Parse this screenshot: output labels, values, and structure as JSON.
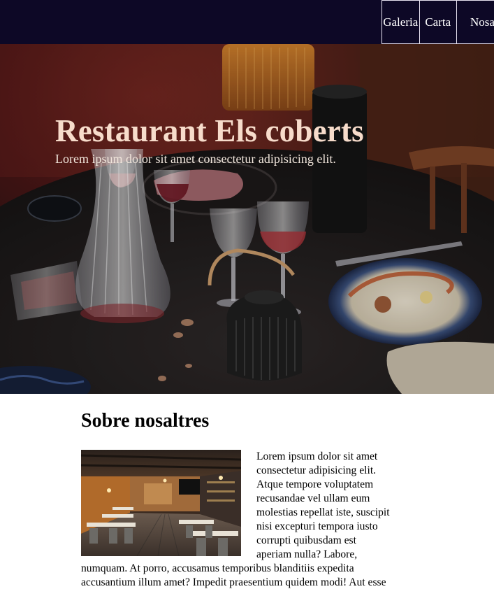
{
  "nav": {
    "items": [
      {
        "label": "Galeria"
      },
      {
        "label": "Carta"
      },
      {
        "label": "Nosaltres"
      }
    ]
  },
  "hero": {
    "title": "Restaurant Els coberts",
    "subtitle": "Lorem ipsum dolor sit amet consectetur adipisicing elit."
  },
  "about": {
    "title": "Sobre nosaltres",
    "text": "Lorem ipsum dolor sit amet consectetur adipisicing elit. Atque tempore voluptatem recusandae vel ullam eum molestias repellat iste, suscipit nisi excepturi tempora iusto corrupti quibusdam est aperiam nulla? Labore, numquam. At porro, accusamus temporibus blanditiis expedita accusantium illum amet? Impedit praesentium quidem modi! Aut esse"
  },
  "colors": {
    "topbar_bg": "#0d0826",
    "hero_title": "#f7dccb",
    "nav_border": "#e9e4f2"
  }
}
